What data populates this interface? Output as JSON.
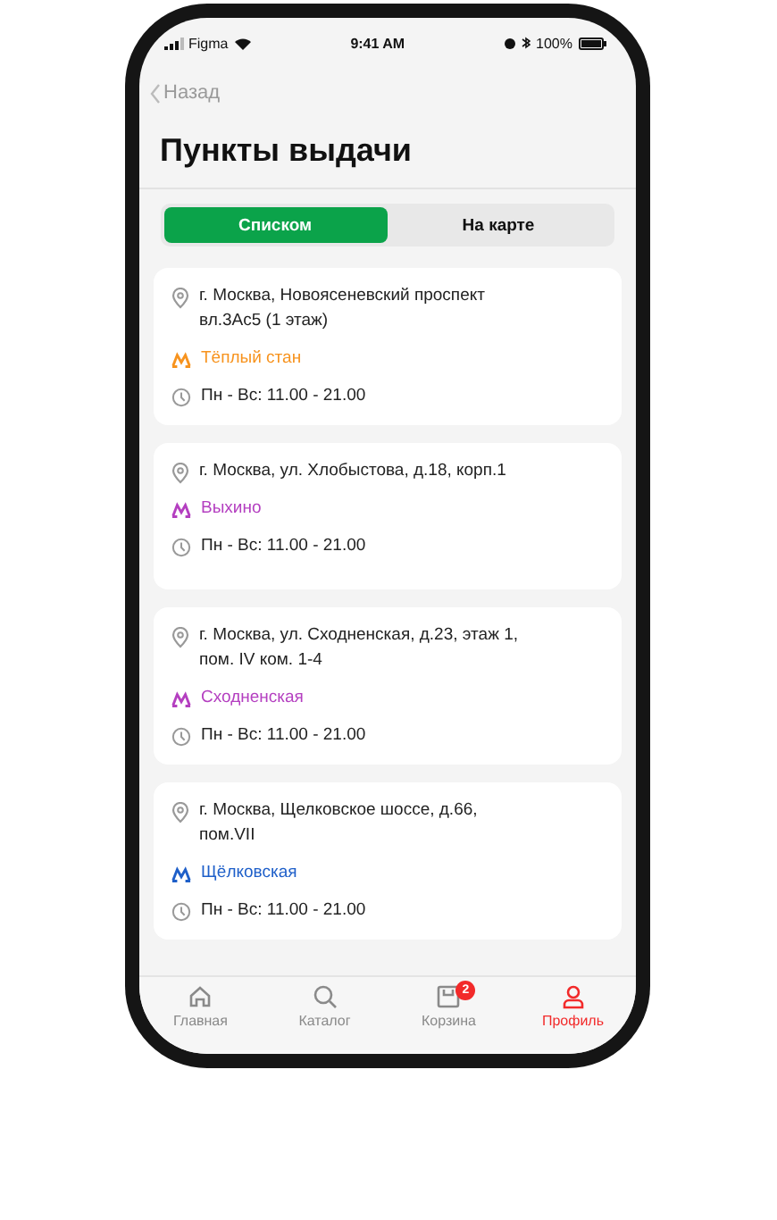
{
  "status_bar": {
    "carrier": "Figma",
    "time": "9:41 AM",
    "battery": "100%"
  },
  "nav": {
    "back": "Назад",
    "title": "Пункты выдачи"
  },
  "segments": [
    {
      "label": "Списком",
      "selected": true
    },
    {
      "label": "На карте",
      "selected": false
    }
  ],
  "points": [
    {
      "address": "г. Москва, Новоясеневский проспект вл.3Ас5 (1 этаж)",
      "station": "Тёплый стан",
      "color": "#f7931e",
      "hours": "Пн - Вс: 11.00 - 21.00"
    },
    {
      "address": "г. Москва, ул. Хлобыстова, д.18, корп.1",
      "station": "Выхино",
      "color": "#b43fc0",
      "hours": "Пн - Вс: 11.00 - 21.00"
    },
    {
      "address": "г. Москва, ул. Сходненская, д.23, этаж 1, пом. IV ком. 1-4",
      "station": "Сходненская",
      "color": "#b43fc0",
      "hours": "Пн - Вс: 11.00 - 21.00"
    },
    {
      "address": "г. Москва, Щелковское шоссе, д.66, пом.VII",
      "station": "Щёлковская",
      "color": "#1e5fc9",
      "hours": "Пн - Вс: 11.00 - 21.00"
    }
  ],
  "tab_bar": [
    {
      "kind": "home",
      "label": "Главная",
      "selected": false
    },
    {
      "kind": "search",
      "label": "Каталог",
      "selected": false
    },
    {
      "kind": "cart",
      "label": "Корзина",
      "selected": false,
      "badge": "2"
    },
    {
      "kind": "profile",
      "label": "Профиль",
      "selected": true
    }
  ]
}
